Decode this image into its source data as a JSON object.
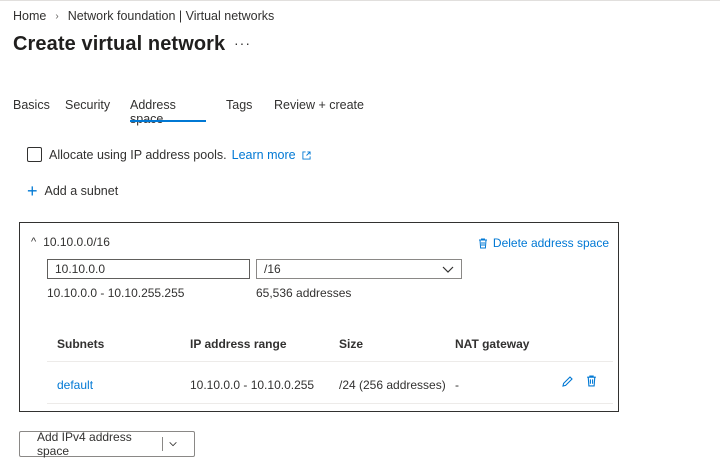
{
  "breadcrumb": {
    "home": "Home",
    "parent": "Network foundation | Virtual networks"
  },
  "page": {
    "title": "Create virtual network",
    "more": "···"
  },
  "tabs": [
    {
      "label": "Basics",
      "active": false
    },
    {
      "label": "Security",
      "active": false
    },
    {
      "label": "Address space",
      "active": true
    },
    {
      "label": "Tags",
      "active": false
    },
    {
      "label": "Review + create",
      "active": false
    }
  ],
  "ipam": {
    "label": "Allocate using IP address pools.",
    "link": "Learn more"
  },
  "add_subnet": {
    "label": "Add a subnet"
  },
  "address_space": {
    "cidr": "10.10.0.0/16",
    "delete_label": "Delete address space",
    "ip_value": "10.10.0.0",
    "mask_value": "/16",
    "range": "10.10.0.0 - 10.10.255.255",
    "count": "65,536 addresses"
  },
  "subnets_table": {
    "headers": [
      "Subnets",
      "IP address range",
      "Size",
      "NAT gateway"
    ],
    "rows": [
      {
        "name": "default",
        "range": "10.10.0.0 - 10.10.0.255",
        "size": "/24 (256 addresses)",
        "nat": "-"
      }
    ]
  },
  "add_ipv4": {
    "label": "Add IPv4 address space"
  },
  "colors": {
    "accent": "#0078d4",
    "text": "#323130"
  }
}
